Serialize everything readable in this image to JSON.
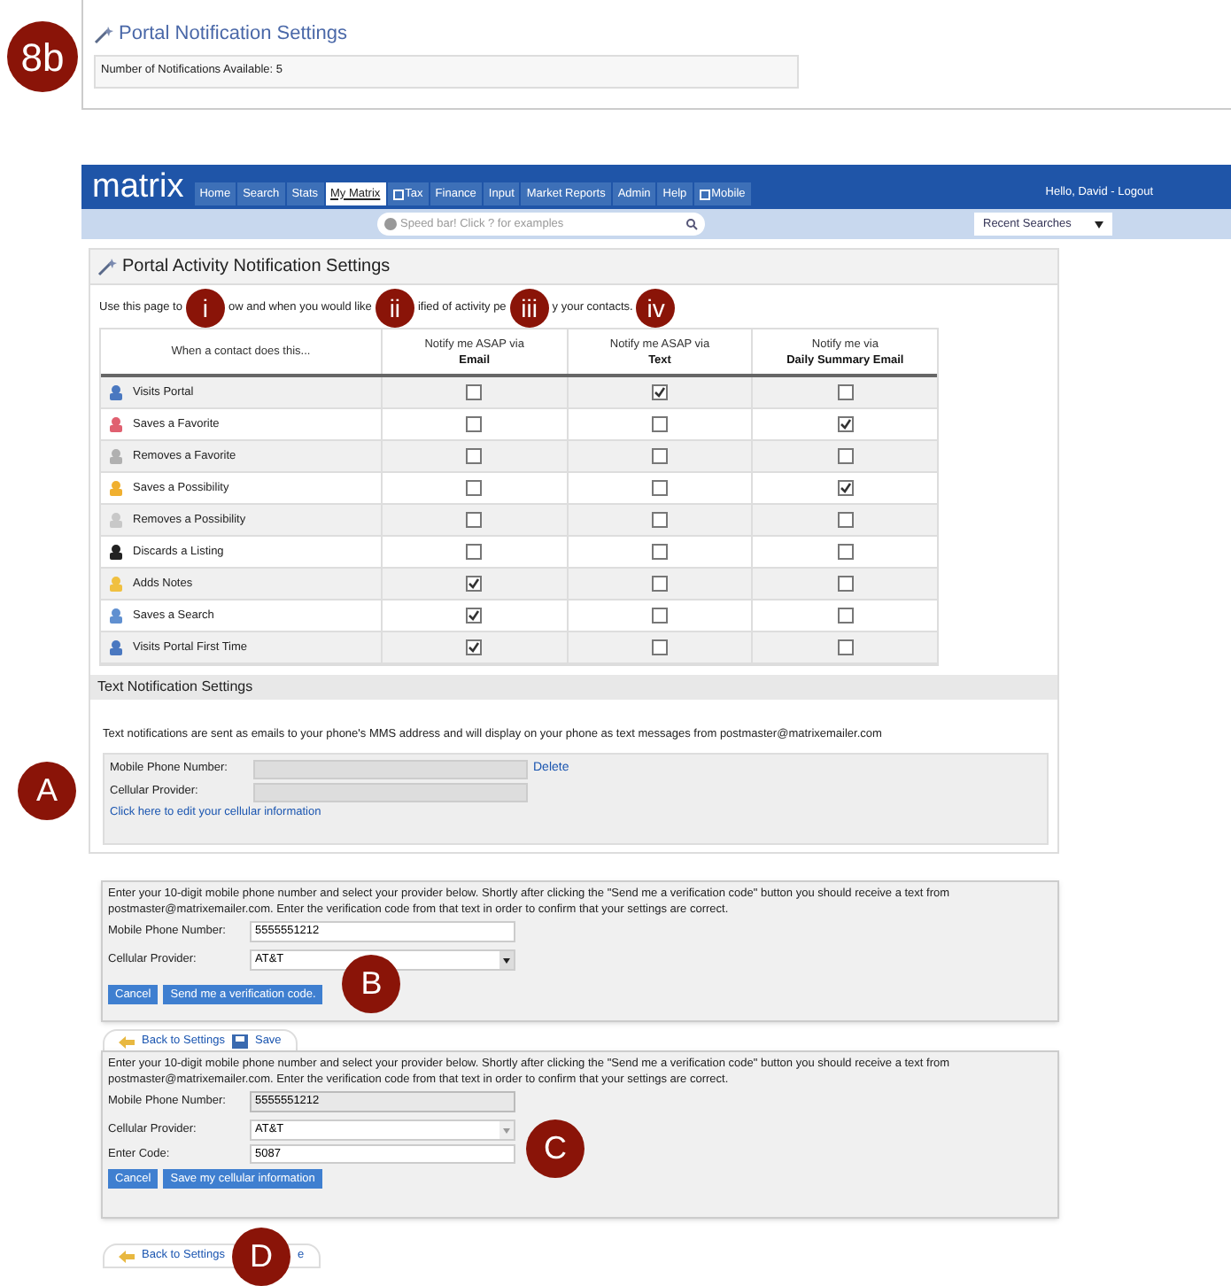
{
  "callouts": {
    "top": "8b",
    "side": "A",
    "b": "B",
    "c": "C",
    "d": "D"
  },
  "portal_settings": {
    "title": "Portal Notification Settings",
    "available": "Number of Notifications Available: 5"
  },
  "header": {
    "logo": "matrix",
    "greeting": "Hello, David - Logout",
    "tabs": [
      {
        "label": "Home",
        "selected": false,
        "icon": false
      },
      {
        "label": "Search",
        "selected": false,
        "icon": false
      },
      {
        "label": "Stats",
        "selected": false,
        "icon": false
      },
      {
        "label": "My Matrix",
        "selected": true,
        "icon": false
      },
      {
        "label": "Tax",
        "selected": false,
        "icon": true
      },
      {
        "label": "Finance",
        "selected": false,
        "icon": false
      },
      {
        "label": "Input",
        "selected": false,
        "icon": false
      },
      {
        "label": "Market Reports",
        "selected": false,
        "icon": false
      },
      {
        "label": "Admin",
        "selected": false,
        "icon": false
      },
      {
        "label": "Help",
        "selected": false,
        "icon": false
      },
      {
        "label": "Mobile",
        "selected": false,
        "icon": true
      }
    ],
    "speed_bar": {
      "placeholder": "Speed bar! Click ? for examples"
    },
    "recent_searches": "Recent Searches"
  },
  "activity": {
    "title": "Portal Activity Notification Settings",
    "intro_parts": [
      {
        "text": "Use this page to",
        "marker": "i"
      },
      {
        "text": "ow and when you would like",
        "marker": "ii"
      },
      {
        "text": "ified of activity pe",
        "marker": "iii"
      },
      {
        "text": "y your contacts.",
        "marker": "iv"
      }
    ],
    "columns": [
      {
        "line1": "When a contact does this..."
      },
      {
        "line1": "Notify me ASAP via",
        "line2": "Email"
      },
      {
        "line1": "Notify me ASAP via",
        "line2": "Text"
      },
      {
        "line1": "Notify me via",
        "line2": "Daily Summary Email"
      }
    ],
    "rows": [
      {
        "label": "Visits Portal",
        "email": false,
        "text": true,
        "daily": false
      },
      {
        "label": "Saves a Favorite",
        "email": false,
        "text": false,
        "daily": true
      },
      {
        "label": "Removes a Favorite",
        "email": false,
        "text": false,
        "daily": false
      },
      {
        "label": "Saves a Possibility",
        "email": false,
        "text": false,
        "daily": true
      },
      {
        "label": "Removes a Possibility",
        "email": false,
        "text": false,
        "daily": false
      },
      {
        "label": "Discards a Listing",
        "email": false,
        "text": false,
        "daily": false
      },
      {
        "label": "Adds Notes",
        "email": true,
        "text": false,
        "daily": false
      },
      {
        "label": "Saves a Search",
        "email": true,
        "text": false,
        "daily": false
      },
      {
        "label": "Visits Portal First Time",
        "email": true,
        "text": false,
        "daily": false
      }
    ]
  },
  "text_settings": {
    "title": "Text Notification Settings",
    "note": "Text notifications are sent as emails to your phone's MMS address and will display on your phone as text messages from postmaster@matrixemailer.com",
    "phone_label": "Mobile Phone Number:",
    "delete": "Delete",
    "provider_label": "Cellular Provider:",
    "edit_link": "Click here to edit your cellular information"
  },
  "verify_panel": {
    "intro": "Enter your 10-digit mobile phone number and select your provider below. Shortly after clicking the \"Send me a verification code\" button you should receive a text from postmaster@matrixemailer.com. Enter the verification code from that text in order to confirm that your settings are correct.",
    "phone_label": "Mobile Phone Number:",
    "phone": "5555551212",
    "provider_label": "Cellular Provider:",
    "provider": "AT&T",
    "cancel": "Cancel",
    "send": "Send me a verification code."
  },
  "back_bar_1": {
    "back": "Back to Settings",
    "save": "Save"
  },
  "confirm_panel": {
    "intro": "Enter your 10-digit mobile phone number and select your provider below. Shortly after clicking the \"Send me a verification code\" button you should receive a text from postmaster@matrixemailer.com. Enter the verification code from that text in order to confirm that your settings are correct.",
    "phone_label": "Mobile Phone Number:",
    "phone": "5555551212",
    "provider_label": "Cellular Provider:",
    "provider": "AT&T",
    "code_label": "Enter Code:",
    "code": "5087",
    "cancel": "Cancel",
    "save": "Save my cellular information"
  },
  "back_bar_2": {
    "back": "Back to Settings",
    "save": "e"
  }
}
